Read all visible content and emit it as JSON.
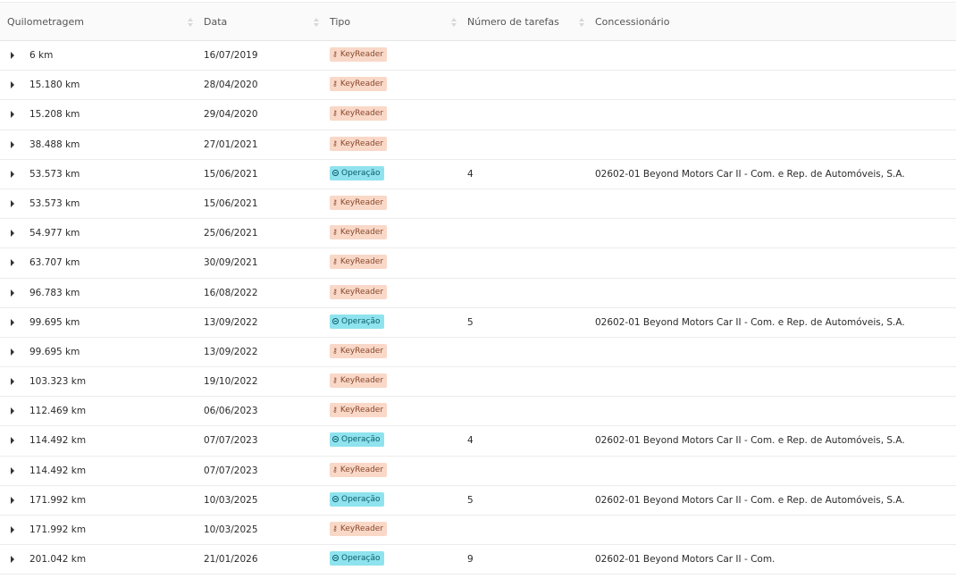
{
  "columns": [
    {
      "key": "km",
      "label": "Quilometragem"
    },
    {
      "key": "date",
      "label": "Data"
    },
    {
      "key": "type",
      "label": "Tipo"
    },
    {
      "key": "tasks",
      "label": "Número de tarefas"
    },
    {
      "key": "dealer",
      "label": "Concessionário"
    }
  ],
  "icons": {
    "keyreader": "key-icon",
    "operacao": "clock-icon",
    "expand": "caret-right-icon",
    "sort": "sort-icon"
  },
  "colors": {
    "keyreader_bg": "#f9d8c8",
    "keyreader_fg": "#8a4a2d",
    "operacao_bg": "#8fe3ee",
    "operacao_fg": "#0b5d69"
  },
  "rows": [
    {
      "km": "6 km",
      "date": "16/07/2019",
      "type": "KeyReader",
      "kind": "kr",
      "tasks": "",
      "dealer": ""
    },
    {
      "km": "15.180 km",
      "date": "28/04/2020",
      "type": "KeyReader",
      "kind": "kr",
      "tasks": "",
      "dealer": ""
    },
    {
      "km": "15.208 km",
      "date": "29/04/2020",
      "type": "KeyReader",
      "kind": "kr",
      "tasks": "",
      "dealer": ""
    },
    {
      "km": "38.488 km",
      "date": "27/01/2021",
      "type": "KeyReader",
      "kind": "kr",
      "tasks": "",
      "dealer": ""
    },
    {
      "km": "53.573 km",
      "date": "15/06/2021",
      "type": "Operação",
      "kind": "op",
      "tasks": "4",
      "dealer": "02602-01 Beyond Motors Car II - Com. e Rep. de Automóveis, S.A."
    },
    {
      "km": "53.573 km",
      "date": "15/06/2021",
      "type": "KeyReader",
      "kind": "kr",
      "tasks": "",
      "dealer": ""
    },
    {
      "km": "54.977 km",
      "date": "25/06/2021",
      "type": "KeyReader",
      "kind": "kr",
      "tasks": "",
      "dealer": ""
    },
    {
      "km": "63.707 km",
      "date": "30/09/2021",
      "type": "KeyReader",
      "kind": "kr",
      "tasks": "",
      "dealer": ""
    },
    {
      "km": "96.783 km",
      "date": "16/08/2022",
      "type": "KeyReader",
      "kind": "kr",
      "tasks": "",
      "dealer": ""
    },
    {
      "km": "99.695 km",
      "date": "13/09/2022",
      "type": "Operação",
      "kind": "op",
      "tasks": "5",
      "dealer": "02602-01 Beyond Motors Car II - Com. e Rep. de Automóveis, S.A."
    },
    {
      "km": "99.695 km",
      "date": "13/09/2022",
      "type": "KeyReader",
      "kind": "kr",
      "tasks": "",
      "dealer": ""
    },
    {
      "km": "103.323 km",
      "date": "19/10/2022",
      "type": "KeyReader",
      "kind": "kr",
      "tasks": "",
      "dealer": ""
    },
    {
      "km": "112.469 km",
      "date": "06/06/2023",
      "type": "KeyReader",
      "kind": "kr",
      "tasks": "",
      "dealer": ""
    },
    {
      "km": "114.492 km",
      "date": "07/07/2023",
      "type": "Operação",
      "kind": "op",
      "tasks": "4",
      "dealer": "02602-01 Beyond Motors Car II - Com. e Rep. de Automóveis, S.A."
    },
    {
      "km": "114.492 km",
      "date": "07/07/2023",
      "type": "KeyReader",
      "kind": "kr",
      "tasks": "",
      "dealer": ""
    },
    {
      "km": "171.992 km",
      "date": "10/03/2025",
      "type": "Operação",
      "kind": "op",
      "tasks": "5",
      "dealer": "02602-01 Beyond Motors Car II - Com. e Rep. de Automóveis, S.A."
    },
    {
      "km": "171.992 km",
      "date": "10/03/2025",
      "type": "KeyReader",
      "kind": "kr",
      "tasks": "",
      "dealer": ""
    },
    {
      "km": "201.042 km",
      "date": "21/01/2026",
      "type": "Operação",
      "kind": "op",
      "tasks": "9",
      "dealer": "02602-01 Beyond Motors Car II - Com."
    }
  ]
}
